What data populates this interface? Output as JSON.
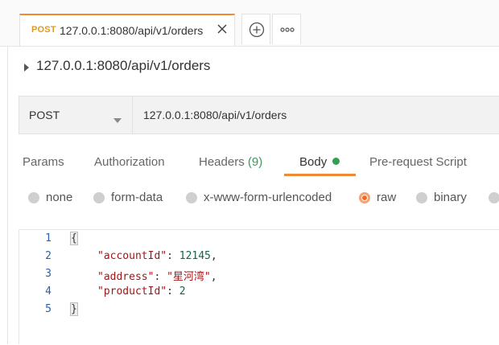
{
  "tabs": [
    {
      "method": "POST",
      "url": "127.0.0.1:8080/api/v1/orders"
    }
  ],
  "breadcrumb": {
    "title": "127.0.0.1:8080/api/v1/orders"
  },
  "request": {
    "method": "POST",
    "url": "127.0.0.1:8080/api/v1/orders"
  },
  "request_tabs": {
    "params": "Params",
    "authorization": "Authorization",
    "headers": "Headers",
    "headers_count": "(9)",
    "body": "Body",
    "prerequest": "Pre-request Script"
  },
  "body_types": {
    "none": "none",
    "form_data": "form-data",
    "urlencoded": "x-www-form-urlencoded",
    "raw": "raw",
    "binary": "binary",
    "selected": "raw"
  },
  "editor": {
    "line_numbers": [
      "1",
      "2",
      "3",
      "4",
      "5"
    ],
    "open_brace": "{",
    "close_brace": "}",
    "fields": [
      {
        "key": "\"accountId\"",
        "value": "12145",
        "suffix": ","
      },
      {
        "key": "\"address\"",
        "value": "\"星河湾\"",
        "suffix": ","
      },
      {
        "key": "\"productId\"",
        "value": "2",
        "suffix": ""
      }
    ]
  },
  "colors": {
    "accent": "#f08a37",
    "method_post": "#e39a1c",
    "body_dot": "#30a14e",
    "headers_count": "#3a9a5a"
  },
  "icons": [
    "close-icon",
    "plus-icon",
    "more-icon",
    "caret-right-icon",
    "chevron-down-icon"
  ]
}
